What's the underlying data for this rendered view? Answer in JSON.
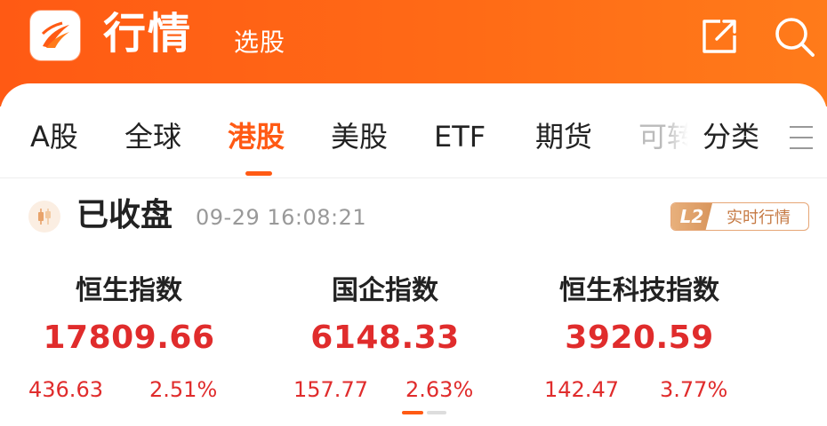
{
  "header": {
    "title": "行情",
    "subtitle": "选股",
    "brand_color": "#ff5a14",
    "icons": [
      "app-logo",
      "share-icon",
      "search-icon"
    ]
  },
  "tabs": {
    "items": [
      "A股",
      "全球",
      "港股",
      "美股",
      "ETF",
      "期货",
      "可转"
    ],
    "active": "港股",
    "category": "分类",
    "menu_icon": "menu-icon"
  },
  "status": {
    "text": "已收盘",
    "time": "09-29 16:08:21",
    "badge_left": "L2",
    "badge_right": "实时行情"
  },
  "indices": [
    {
      "name": "恒生指数",
      "value": "17809.66",
      "change": "436.63",
      "pct": "2.51%"
    },
    {
      "name": "国企指数",
      "value": "6148.33",
      "change": "157.77",
      "pct": "2.63%"
    },
    {
      "name": "恒生科技指数",
      "value": "3920.59",
      "change": "142.47",
      "pct": "3.77%"
    }
  ],
  "colors": {
    "up": "#e02c2c",
    "accent": "#ff5a14",
    "badge": "#d8955c"
  }
}
